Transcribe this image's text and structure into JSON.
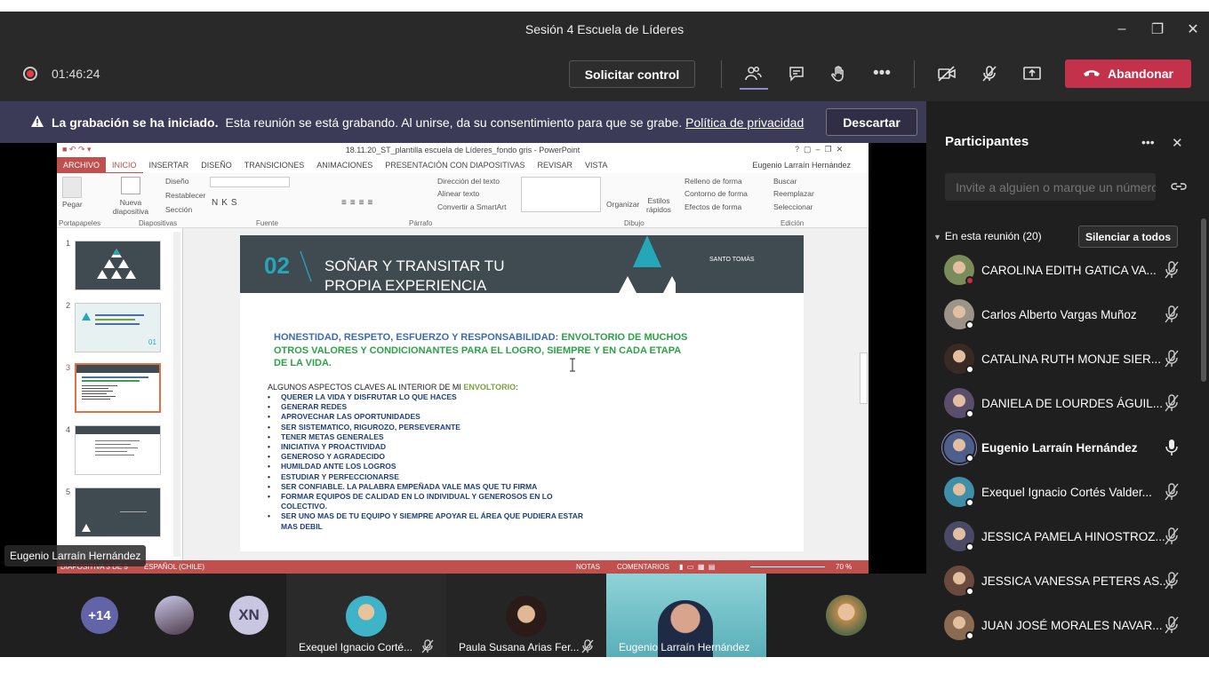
{
  "window": {
    "title": "Sesión 4 Escuela de Líderes",
    "minimize": "–",
    "maximize": "❐",
    "close": "✕"
  },
  "toolbar": {
    "timer": "01:46:24",
    "request_control": "Solicitar control",
    "leave": "Abandonar",
    "more": "•••"
  },
  "banner": {
    "title": "La grabación se ha iniciado.",
    "message": "Esta reunión se está grabando. Al unirse, da su consentimiento para que se grabe.",
    "link": "Política de privacidad",
    "dismiss": "Descartar"
  },
  "ppt": {
    "title": "18.11.20_ST_plantilla escuela de Líderes_fondo gris - PowerPoint",
    "tabs": [
      "ARCHIVO",
      "INICIO",
      "INSERTAR",
      "DISEÑO",
      "TRANSICIONES",
      "ANIMACIONES",
      "PRESENTACIÓN CON DIAPOSITIVAS",
      "REVISAR",
      "VISTA"
    ],
    "user": "Eugenio Larraín Hernández",
    "ribbon": {
      "paste": "Pegar",
      "new_slide": "Nueva diapositiva",
      "layout": "Diseño",
      "reset": "Restablecer",
      "section": "Sección",
      "text_direction": "Dirección del texto",
      "align_text": "Alinear texto",
      "smartart": "Convertir a SmartArt",
      "arrange": "Organizar",
      "quick_styles": "Estilos rápidos",
      "shape_fill": "Relleno de forma",
      "shape_outline": "Contorno de forma",
      "shape_effects": "Efectos de forma",
      "find": "Buscar",
      "replace": "Reemplazar",
      "select": "Seleccionar",
      "groups": [
        "Portapapeles",
        "Diapositivas",
        "Fuente",
        "Párrafo",
        "Dibujo",
        "Edición"
      ]
    },
    "thumb_numbers": [
      "1",
      "2",
      "3",
      "4",
      "5"
    ],
    "slide": {
      "number": "02",
      "title_line1": "SOÑAR Y TRANSITAR TU",
      "title_line2": "PROPIA EXPERIENCIA",
      "brand": "SANTO TOMÁS",
      "intro_blue": "HONESTIDAD,  RESPETO, ESFUERZO Y RESPONSABILIDAD:",
      "intro_green": "ENVOLTORIO DE MUCHOS OTROS VALORES Y CONDICIONANTES PARA EL LOGRO,  SIEMPRE Y EN CADA ETAPA DE LA VIDA.",
      "aspects_prefix": "ALGUNOS ASPECTOS CLAVES AL INTERIOR DE MI",
      "aspects_word": "ENVOLTORIO",
      "bullets": [
        "QUERER LA VIDA Y DISFRUTAR LO QUE HACES",
        "GENERAR REDES",
        "APROVECHAR LAS OPORTUNIDADES",
        "SER SISTEMATICO, RIGUROZO, PERSEVERANTE",
        "TENER METAS GENERALES",
        "INICIATIVA Y PROACTIVIDAD",
        "GENEROSO Y AGRADECIDO",
        "HUMILDAD ANTE LOS LOGROS",
        "ESTUDIAR Y PERFECCIONARSE",
        "SER CONFIABLE. LA PALABRA EMPEÑADA VALE MAS QUE TU FIRMA",
        "FORMAR EQUIPOS  DE CALIDAD  EN LO INDIVIDUAL Y GENEROSOS EN LO COLECTIVO.",
        "SER UNO MAS DE TU EQUIPO Y SIEMPRE APOYAR EL  ÁREA  QUE PUDIERA ESTAR MAS DEBIL"
      ]
    },
    "status": {
      "slide_info": "DIAPOSITIVA 3 DE 5",
      "lang": "ESPAÑOL (CHILE)",
      "notes": "NOTAS",
      "comments": "COMENTARIOS",
      "zoom": "70 %"
    }
  },
  "stage": {
    "speaker": "Eugenio Larraín Hernández"
  },
  "strip": {
    "more_count": "+14",
    "initials": "XN",
    "tiles": [
      {
        "name": "Exequel Ignacio Corté..."
      },
      {
        "name": "Paula Susana Arias Fer..."
      },
      {
        "name": "Eugenio Larraín Hernández"
      }
    ]
  },
  "panel": {
    "title": "Participantes",
    "more": "•••",
    "invite_placeholder": "Invite a alguien o marque un número",
    "in_meeting": "En esta reunión (20)",
    "mute_all": "Silenciar a todos",
    "participants": [
      {
        "name": "CAROLINA EDITH GATICA VA...",
        "color": "#7a8c5a"
      },
      {
        "name": "Carlos Alberto Vargas Muñoz",
        "color": "#9c9488"
      },
      {
        "name": "CATALINA RUTH MONJE SIER...",
        "color": "#3a2a24"
      },
      {
        "name": "DANIELA DE LOURDES ÁGUIL...",
        "color": "#5a4e6c"
      },
      {
        "name": "Eugenio Larraín Hernández",
        "color": "#4e5f8c"
      },
      {
        "name": "Exequel Ignacio Cortés Valder...",
        "color": "#3f8fa8"
      },
      {
        "name": "JESSICA PAMELA HINOSTROZ...",
        "color": "#4a4a66"
      },
      {
        "name": "JESSICA VANESSA PETERS AS...",
        "color": "#6b4a3e"
      },
      {
        "name": "JUAN JOSÉ MORALES NAVAR...",
        "color": "#8a6a50"
      }
    ]
  }
}
